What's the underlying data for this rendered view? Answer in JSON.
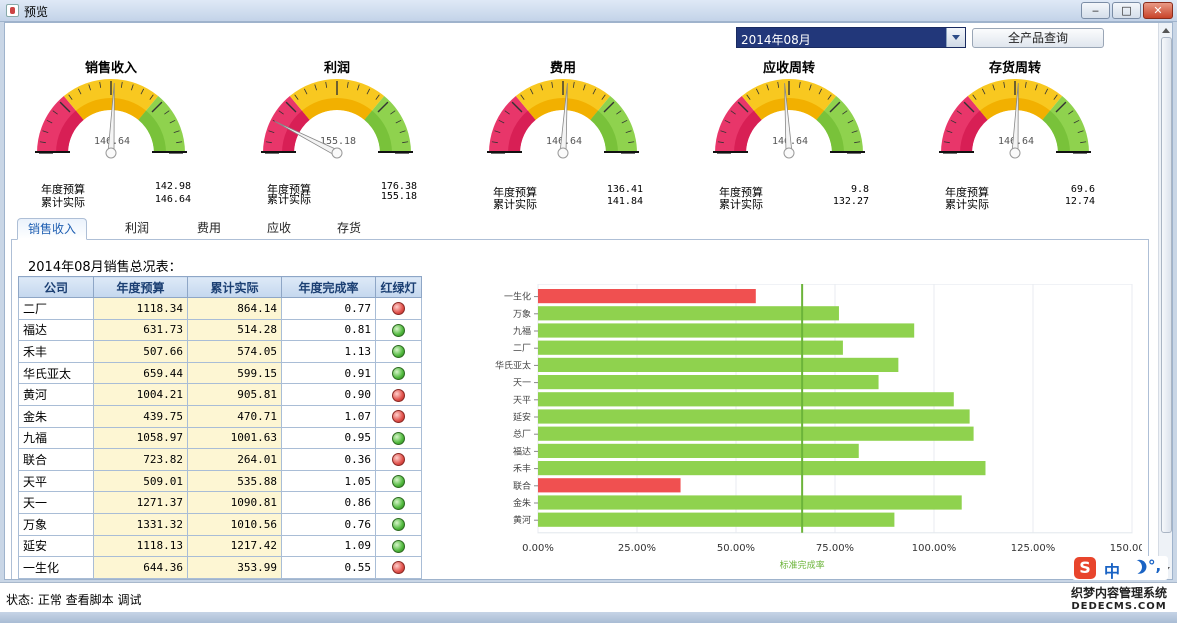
{
  "window": {
    "title": "预览",
    "min": "‒",
    "max": "□",
    "close": "✕"
  },
  "toolbar": {
    "month": "2014年08月",
    "query_button": "全产品查询"
  },
  "gauges": [
    {
      "title": "销售收入",
      "value": "146.64",
      "budget_label": "年度预算",
      "budget": "142.98",
      "actual_label": "累计实际",
      "actual": "146.64",
      "needle_ratio": 1.03
    },
    {
      "title": "利润",
      "value": "155.18",
      "budget_label": "年度预算",
      "budget": "176.38",
      "actual_label": "累计实际",
      "actual": "155.18",
      "needle_ratio": 0.3
    },
    {
      "title": "费用",
      "value": "146.64",
      "budget_label": "年度预算",
      "budget": "136.41",
      "actual_label": "累计实际",
      "actual": "141.84",
      "needle_ratio": 1.04
    },
    {
      "title": "应收周转",
      "value": "146.64",
      "budget_label": "年度预算",
      "budget": "9.8",
      "actual_label": "累计实际",
      "actual": "132.27",
      "needle_ratio": 0.96
    },
    {
      "title": "存货周转",
      "value": "146.64",
      "budget_label": "年度预算",
      "budget": "69.6",
      "actual_label": "累计实际",
      "actual": "12.74",
      "needle_ratio": 1.03
    }
  ],
  "gauge_colors": {
    "red": "#e8366a",
    "yellow": "#f8c820",
    "green": "#8fd24e"
  },
  "tabs": [
    "销售收入",
    "利润",
    "费用",
    "应收",
    "存货"
  ],
  "report": {
    "title": "2014年08月销售总况表：",
    "columns": [
      "公司",
      "年度预算",
      "累计实际",
      "年度完成率",
      "红绿灯"
    ],
    "rows": [
      {
        "company": "二厂",
        "budget": "1118.34",
        "actual": "864.14",
        "rate": "0.77",
        "light": "red"
      },
      {
        "company": "福达",
        "budget": "631.73",
        "actual": "514.28",
        "rate": "0.81",
        "light": "green"
      },
      {
        "company": "禾丰",
        "budget": "507.66",
        "actual": "574.05",
        "rate": "1.13",
        "light": "green"
      },
      {
        "company": "华氏亚太",
        "budget": "659.44",
        "actual": "599.15",
        "rate": "0.91",
        "light": "green"
      },
      {
        "company": "黄河",
        "budget": "1004.21",
        "actual": "905.81",
        "rate": "0.90",
        "light": "red"
      },
      {
        "company": "金朱",
        "budget": "439.75",
        "actual": "470.71",
        "rate": "1.07",
        "light": "red"
      },
      {
        "company": "九福",
        "budget": "1058.97",
        "actual": "1001.63",
        "rate": "0.95",
        "light": "green"
      },
      {
        "company": "联合",
        "budget": "723.82",
        "actual": "264.01",
        "rate": "0.36",
        "light": "red"
      },
      {
        "company": "天平",
        "budget": "509.01",
        "actual": "535.88",
        "rate": "1.05",
        "light": "green"
      },
      {
        "company": "天一",
        "budget": "1271.37",
        "actual": "1090.81",
        "rate": "0.86",
        "light": "green"
      },
      {
        "company": "万象",
        "budget": "1331.32",
        "actual": "1010.56",
        "rate": "0.76",
        "light": "green"
      },
      {
        "company": "延安",
        "budget": "1118.13",
        "actual": "1217.42",
        "rate": "1.09",
        "light": "green"
      },
      {
        "company": "一生化",
        "budget": "644.36",
        "actual": "353.99",
        "rate": "0.55",
        "light": "red"
      }
    ]
  },
  "chart_data": {
    "type": "bar",
    "orientation": "horizontal",
    "categories": [
      "一生化",
      "万象",
      "九福",
      "二厂",
      "华氏亚太",
      "天一",
      "天平",
      "延安",
      "总厂",
      "福达",
      "禾丰",
      "联合",
      "金朱",
      "黄河"
    ],
    "values": [
      55,
      76,
      95,
      77,
      91,
      86,
      105,
      109,
      110,
      81,
      113,
      36,
      107,
      90
    ],
    "bar_colors": [
      "#f05050",
      "#8fd24e",
      "#8fd24e",
      "#8fd24e",
      "#8fd24e",
      "#8fd24e",
      "#8fd24e",
      "#8fd24e",
      "#8fd24e",
      "#8fd24e",
      "#8fd24e",
      "#f05050",
      "#8fd24e",
      "#8fd24e"
    ],
    "xlim": [
      0,
      150
    ],
    "x_ticks": [
      "0.00%",
      "25.00%",
      "50.00%",
      "75.00%",
      "100.00%",
      "125.00%",
      "150.00%"
    ],
    "reference_value": 66.7,
    "reference_label": "标准完成率",
    "legend": "年度完成率",
    "grid": true
  },
  "status": {
    "text": "状态:  正常 查看脚本 调试"
  },
  "ime": {
    "logo": "S",
    "lang": "中",
    "punct": "°,"
  },
  "watermark": {
    "line1": "织梦内容管理系统",
    "line2": "DEDECMS.COM"
  }
}
